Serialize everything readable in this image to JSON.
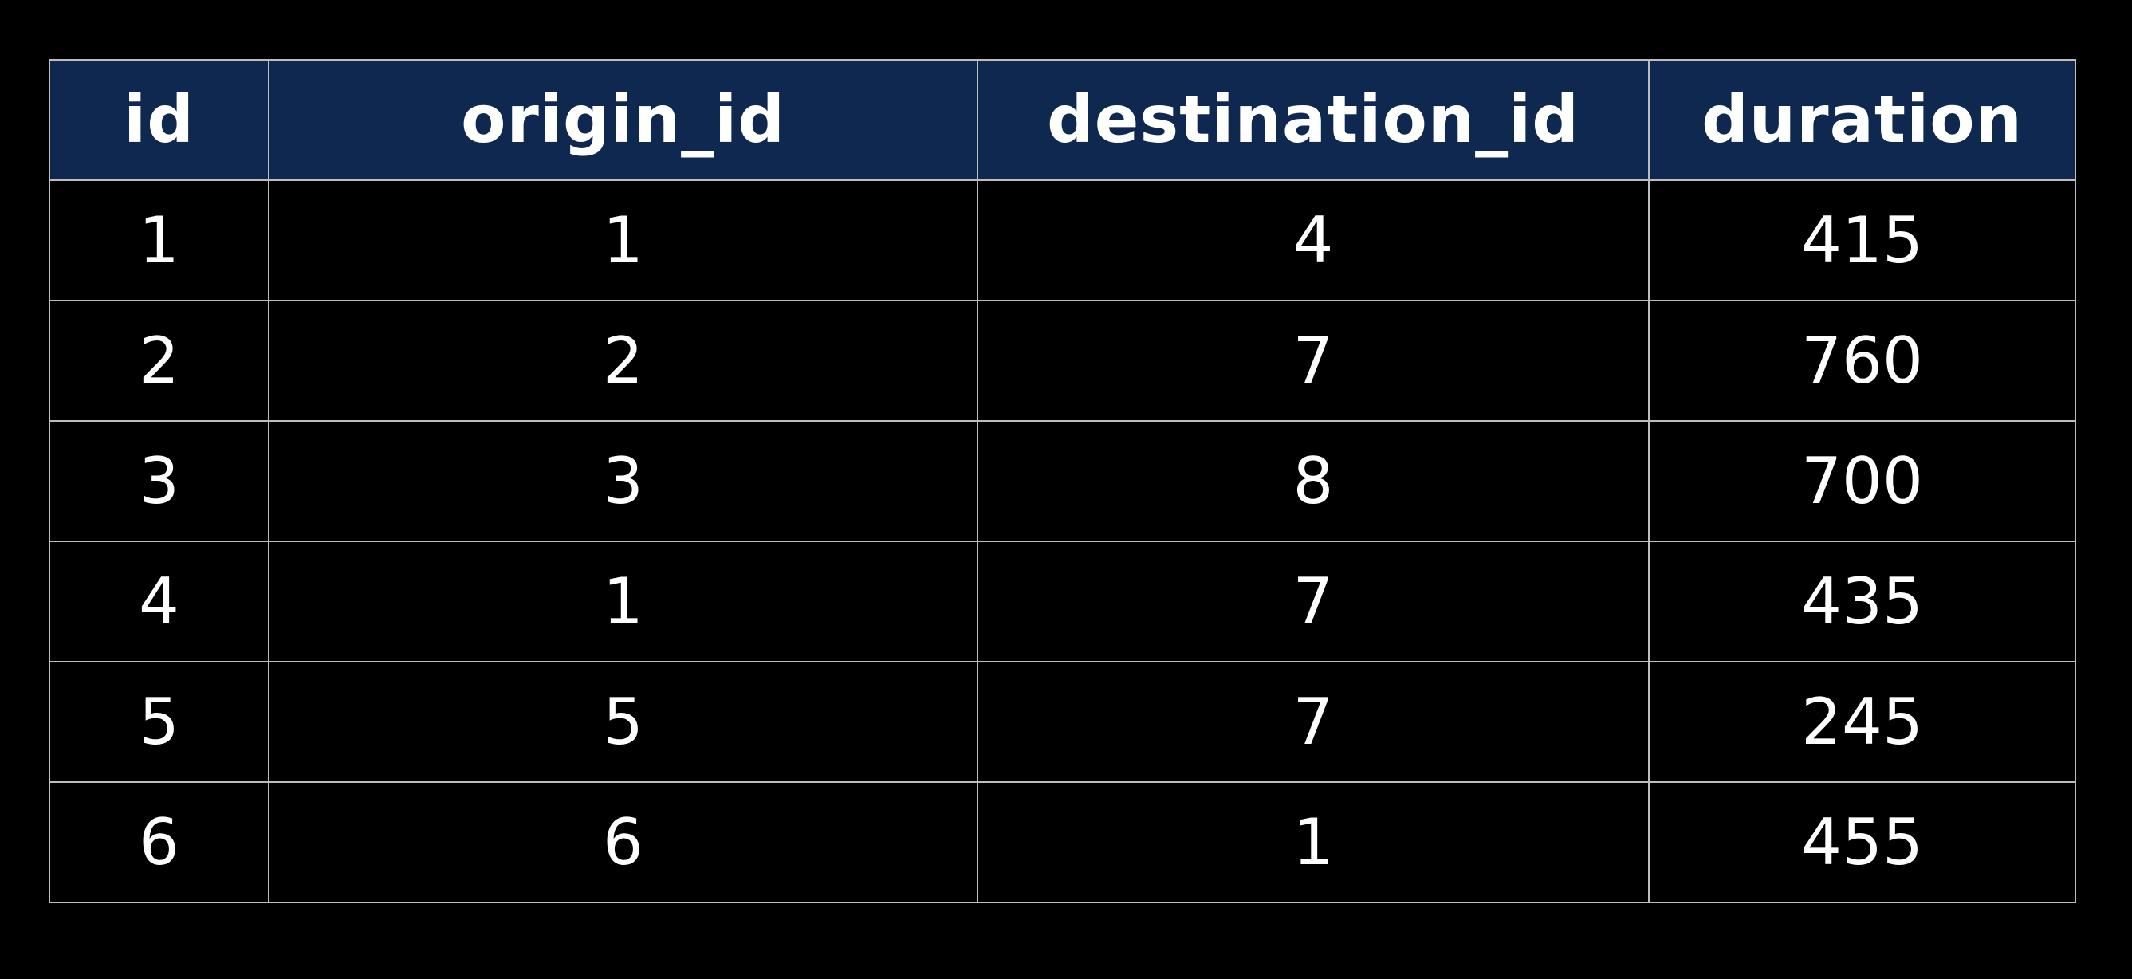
{
  "table": {
    "columns": [
      "id",
      "origin_id",
      "destination_id",
      "duration"
    ],
    "rows": [
      [
        "1",
        "1",
        "4",
        "415"
      ],
      [
        "2",
        "2",
        "7",
        "760"
      ],
      [
        "3",
        "3",
        "8",
        "700"
      ],
      [
        "4",
        "1",
        "7",
        "435"
      ],
      [
        "5",
        "5",
        "7",
        "245"
      ],
      [
        "6",
        "6",
        "1",
        "455"
      ]
    ]
  },
  "colors": {
    "background": "#000000",
    "header_background": "#0f2850",
    "grid_lines": "#bdbdbd",
    "text": "#ffffff"
  }
}
